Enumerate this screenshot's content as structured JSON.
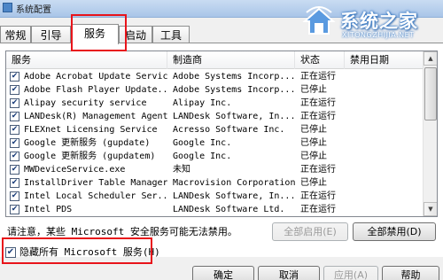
{
  "window": {
    "title": "系统配置"
  },
  "watermark": {
    "main": "系统之家",
    "sub": "XITONGZHIJIA.NET"
  },
  "tabs": [
    {
      "label": "常规"
    },
    {
      "label": "引导"
    },
    {
      "label": "服务"
    },
    {
      "label": "启动"
    },
    {
      "label": "工具"
    }
  ],
  "columns": {
    "service": "服务",
    "manufacturer": "制造商",
    "status": "状态",
    "disabled_date": "禁用日期"
  },
  "services": [
    {
      "name": "Adobe Acrobat Update Service",
      "manufacturer": "Adobe Systems Incorp...",
      "status": "正在运行",
      "checked": "✔"
    },
    {
      "name": "Adobe Flash Player Update...",
      "manufacturer": "Adobe Systems Incorp...",
      "status": "已停止",
      "checked": "✔"
    },
    {
      "name": "Alipay security service",
      "manufacturer": "Alipay Inc.",
      "status": "正在运行",
      "checked": "✔"
    },
    {
      "name": "LANDesk(R) Management Agent",
      "manufacturer": "LANDesk Software, In...",
      "status": "正在运行",
      "checked": "✔"
    },
    {
      "name": "FLEXnet Licensing Service",
      "manufacturer": "Acresso Software Inc.",
      "status": "已停止",
      "checked": "✔"
    },
    {
      "name": "Google 更新服务 (gupdate)",
      "manufacturer": "Google Inc.",
      "status": "已停止",
      "checked": "✔"
    },
    {
      "name": "Google 更新服务 (gupdatem)",
      "manufacturer": "Google Inc.",
      "status": "已停止",
      "checked": "✔"
    },
    {
      "name": "MWDeviceService.exe",
      "manufacturer": "未知",
      "status": "正在运行",
      "checked": "✔"
    },
    {
      "name": "InstallDriver Table Manager",
      "manufacturer": "Macrovision Corporation",
      "status": "已停止",
      "checked": "✔"
    },
    {
      "name": "Intel Local Scheduler Ser...",
      "manufacturer": "LANDesk Software, In...",
      "status": "正在运行",
      "checked": "✔"
    },
    {
      "name": "Intel PDS",
      "manufacturer": "LANDesk Software Ltd.",
      "status": "正在运行",
      "checked": "✔"
    }
  ],
  "note": "请注意，某些 Microsoft 安全服务可能无法禁用。",
  "buttons": {
    "enable_all": "全部启用(E)",
    "disable_all": "全部禁用(D)",
    "ok": "确定",
    "cancel": "取消",
    "apply": "应用(A)",
    "help": "帮助"
  },
  "hide_ms": {
    "label": "隐藏所有 Microsoft 服务(H)",
    "checked": "✔"
  }
}
